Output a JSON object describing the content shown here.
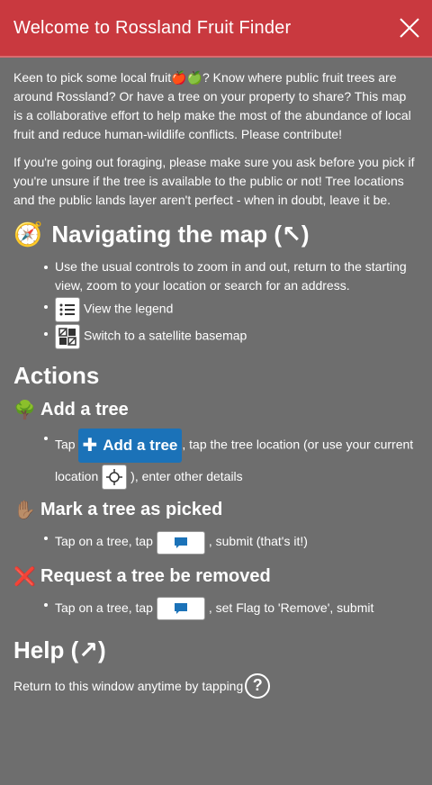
{
  "header": {
    "title": "Welcome to Rossland Fruit Finder"
  },
  "intro": {
    "p1": "Keen to pick some local fruit🍎🍏? Know where public fruit trees are around Rossland? Or have a tree on your property to share? This map is a collaborative effort to help make the most of the abundance of local fruit and reduce human-wildlife conflicts. Please contribute!",
    "p2": "If you're going out foraging, please make sure you ask before you pick if you're unsure if the tree is available to the public or not! Tree locations and the public lands layer aren't perfect - when in doubt, leave it be."
  },
  "navigating": {
    "emoji": "🧭",
    "title": "Navigating the map (↖)",
    "items": [
      "Use the usual controls to zoom in and out, return to the starting view, zoom to your location or search for an address.",
      "View the legend",
      "Switch to a satellite basemap"
    ]
  },
  "actions": {
    "title": "Actions",
    "add": {
      "emoji": "🌳",
      "title": "Add a tree",
      "tap": "Tap",
      "button_label": "Add a tree",
      "rest1": ", tap the tree location (or use your current location",
      "rest2": "), enter other details"
    },
    "picked": {
      "emoji": "✋🏽",
      "title": "Mark a tree as picked",
      "pre": "Tap on a tree, tap",
      "post": ", submit (that's it!)"
    },
    "remove": {
      "emoji": "❌",
      "title": "Request a tree be removed",
      "pre": "Tap on a tree, tap",
      "post": ", set Flag to 'Remove', submit"
    }
  },
  "help": {
    "title": "Help (↗)",
    "text": "Return to this window anytime by tapping",
    "icon_glyph": "?"
  },
  "colors": {
    "header": "#c9393f",
    "background": "#6e6e6e",
    "button": "#1b72b8"
  }
}
